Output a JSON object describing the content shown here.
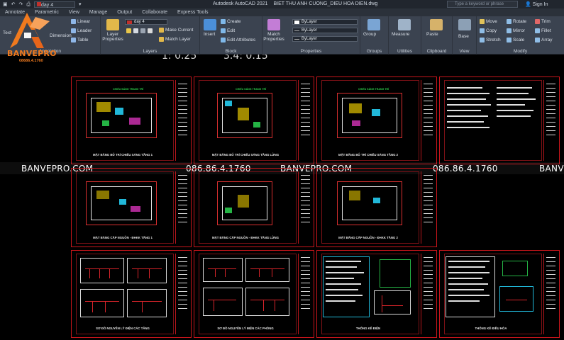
{
  "titlebar": {
    "layer_value": "day 4",
    "app_title": "Autodesk AutoCAD 2021",
    "file_name": "BIET THU ANH CUONG_DIEU HOA DIEN.dwg",
    "search_placeholder": "Type a keyword or phrase",
    "signin": "Sign In"
  },
  "tabs": [
    "Annotate",
    "Parametric",
    "View",
    "Manage",
    "Output",
    "Collaborate",
    "Express Tools"
  ],
  "ribbon": {
    "annotation": {
      "title": "Annotation",
      "text_label": "Text",
      "dimension_label": "Dimension",
      "linear": "Linear",
      "leader": "Leader",
      "table": "Table"
    },
    "layers": {
      "title": "Layers",
      "props_label": "Layer Properties",
      "current_layer": "day 4",
      "make_current": "Make Current",
      "match_layer": "Match Layer"
    },
    "block": {
      "title": "Block",
      "insert": "Insert",
      "create": "Create",
      "edit": "Edit",
      "edit_attributes": "Edit Attributes"
    },
    "properties": {
      "title": "Properties",
      "match_label": "Match Properties",
      "color": "ByLayer",
      "linetype": "ByLayer",
      "lineweight": "ByLayer"
    },
    "groups": {
      "title": "Groups",
      "group": "Group"
    },
    "utilities": {
      "title": "Utilities",
      "measure": "Measure"
    },
    "clipboard": {
      "title": "Clipboard",
      "paste": "Paste"
    },
    "view": {
      "title": "View",
      "base": "Base"
    },
    "modify": {
      "title": "Modify",
      "move": "Move",
      "copy": "Copy",
      "stretch": "Stretch",
      "rotate": "Rotate",
      "mirror": "Mirror",
      "scale": "Scale",
      "trim": "Trim",
      "fillet": "Fillet",
      "array": "Array"
    }
  },
  "logo": {
    "brand": "BANVEPRO",
    "phone": "08686.4.1760"
  },
  "model": {
    "scale_left": "1: 0.25",
    "scale_right": "3.4: 0.15",
    "watermarks": [
      "BANVEPRO.COM",
      "086.86.4.1760",
      "BANVEPRO.COM",
      "086.86.4.1760",
      "BANVEPRO.COM"
    ],
    "sheet_titles": {
      "row1": [
        "MẶT BẰNG BỐ TRÍ CHIẾU SÁNG TẦNG 1",
        "MẶT BẰNG BỐ TRÍ CHIẾU SÁNG TẦNG LỬNG",
        "MẶT BẰNG BỐ TRÍ CHIẾU SÁNG TẦNG 2"
      ],
      "row2": [
        "MẶT BẰNG CẤP NGUỒN - ĐHKK TẦNG 1",
        "MẶT BẰNG CẤP NGUỒN - ĐHKK TẦNG LỬNG",
        "MẶT BẰNG CẤP NGUỒN - ĐHKK TẦNG 2"
      ],
      "row3": [
        "SƠ ĐỒ NGUYÊN LÝ ĐIỆN CÁC TẦNG",
        "SƠ ĐỒ NGUYÊN LÝ ĐIỆN CÁC PHÒNG",
        "THỐNG KÊ ĐIỆN",
        "THỐNG KÊ ĐIỀU HÒA"
      ]
    },
    "plan_header": "CHIẾU SÁNG TRANG TRÍ"
  },
  "colors": {
    "ribbon": "#3b4350",
    "frame_red": "#c8151b",
    "logo_orange": "#f07a1e"
  }
}
